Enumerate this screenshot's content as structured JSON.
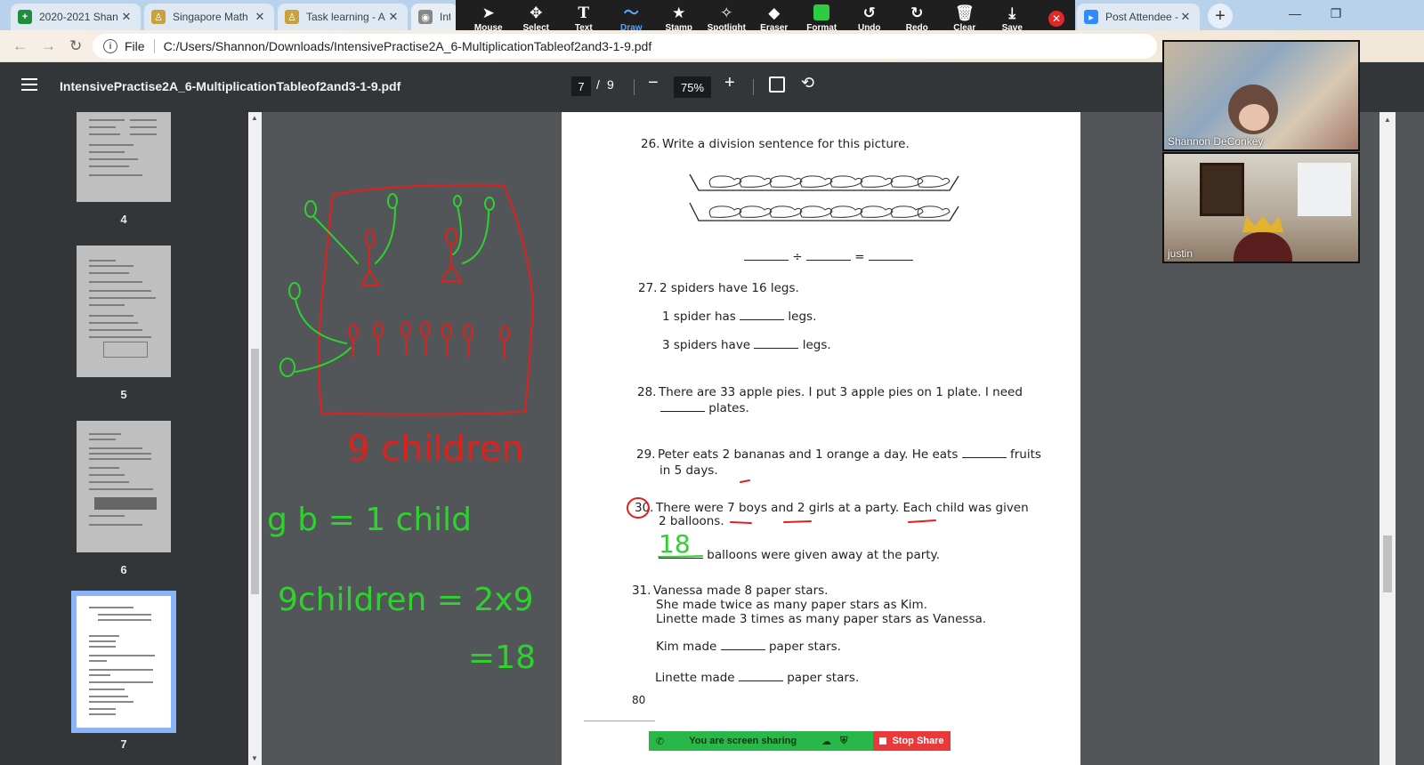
{
  "browser": {
    "tabs": [
      {
        "title": "2020-2021 Shan",
        "fav": "+",
        "fav_color": "#1e8e3e"
      },
      {
        "title": "Singapore Math",
        "fav": "♙",
        "fav_color": "#c9a23b"
      },
      {
        "title": "Task learning - A",
        "fav": "♙",
        "fav_color": "#c9a23b"
      },
      {
        "title": "Inte",
        "fav": "◉",
        "fav_color": "#888888"
      },
      {
        "title": "Post Attendee -",
        "fav": "▸",
        "fav_color": "#2d8cff"
      }
    ],
    "new_tab": "+",
    "address": "C:/Users/Shannon/Downloads/IntensivePractise2A_6-MultiplicationTableof2and3-1-9.pdf",
    "address_scheme": "File"
  },
  "annotate": {
    "tools": [
      {
        "label": "Mouse",
        "icon": "arrow-cursor-icon",
        "glyph": "➤"
      },
      {
        "label": "Select",
        "icon": "move-icon",
        "glyph": "✥"
      },
      {
        "label": "Text",
        "icon": "text-icon",
        "glyph": "T"
      },
      {
        "label": "Draw",
        "icon": "draw-icon",
        "glyph": "〜"
      },
      {
        "label": "Stamp",
        "icon": "star-icon",
        "glyph": "★"
      },
      {
        "label": "Spotlight",
        "icon": "wand-icon",
        "glyph": "✧"
      },
      {
        "label": "Eraser",
        "icon": "eraser-icon",
        "glyph": "◆"
      },
      {
        "label": "Format",
        "icon": "format-icon",
        "glyph": "■"
      },
      {
        "label": "Undo",
        "icon": "undo-icon",
        "glyph": "↺"
      },
      {
        "label": "Redo",
        "icon": "redo-icon",
        "glyph": "↻"
      },
      {
        "label": "Clear",
        "icon": "trash-icon",
        "glyph": "🗑"
      },
      {
        "label": "Save",
        "icon": "save-icon",
        "glyph": "⤓"
      }
    ],
    "active_tool": "Draw",
    "active_color": "#58a6ff",
    "format_color": "#2ecc40"
  },
  "pdf": {
    "filename": "IntensivePractise2A_6-MultiplicationTableof2and3-1-9.pdf",
    "current_page": "7",
    "page_sep": "/",
    "total_pages": "9",
    "zoom": "75%",
    "thumb_labels": [
      "4",
      "5",
      "6",
      "7"
    ]
  },
  "worksheet": {
    "q26": {
      "num": "26.",
      "text": "Write a division sentence for this picture.",
      "div": "÷",
      "eq": "="
    },
    "q27": {
      "num": "27.",
      "text": "2 spiders have 16 legs.",
      "line1a": "1 spider has",
      "line1b": "legs.",
      "line2a": "3 spiders have",
      "line2b": "legs."
    },
    "q28": {
      "num": "28.",
      "line1": "There are 33 apple pies. I put 3 apple pies on 1 plate. I need",
      "line2": "plates."
    },
    "q29": {
      "num": "29.",
      "line1a": "Peter eats 2 bananas and 1 orange a day. He eats",
      "line1b": "fruits",
      "line2": "in 5 days."
    },
    "q30": {
      "num": "30.",
      "line1": "There were 7 boys and 2 girls at a party. Each child was given",
      "line2": "2 balloons.",
      "line3": "balloons were given away at the party.",
      "answer": "18"
    },
    "q31": {
      "num": "31.",
      "line1": "Vanessa made 8 paper stars.",
      "line2": "She made twice as many paper stars as Kim.",
      "line3": "Linette made 3 times as many paper stars as Vanessa.",
      "line4a": "Kim made",
      "line4b": "paper stars.",
      "line5a": "Linette made",
      "line5b": "paper stars."
    },
    "page_number": "80"
  },
  "annotations": {
    "children_note": "9 children",
    "gb_note": "g b = 1 child",
    "calc_line1": "9children = 2x9",
    "calc_line2": "=18",
    "colors": {
      "red": "#e0201b",
      "green": "#2fd12f"
    }
  },
  "participants": [
    {
      "name": "Shannon DeConkey"
    },
    {
      "name": "justin"
    }
  ],
  "share": {
    "status": "You are screen sharing",
    "stop": "Stop Share",
    "green": "#2ab74a",
    "red": "#e83a3a"
  }
}
